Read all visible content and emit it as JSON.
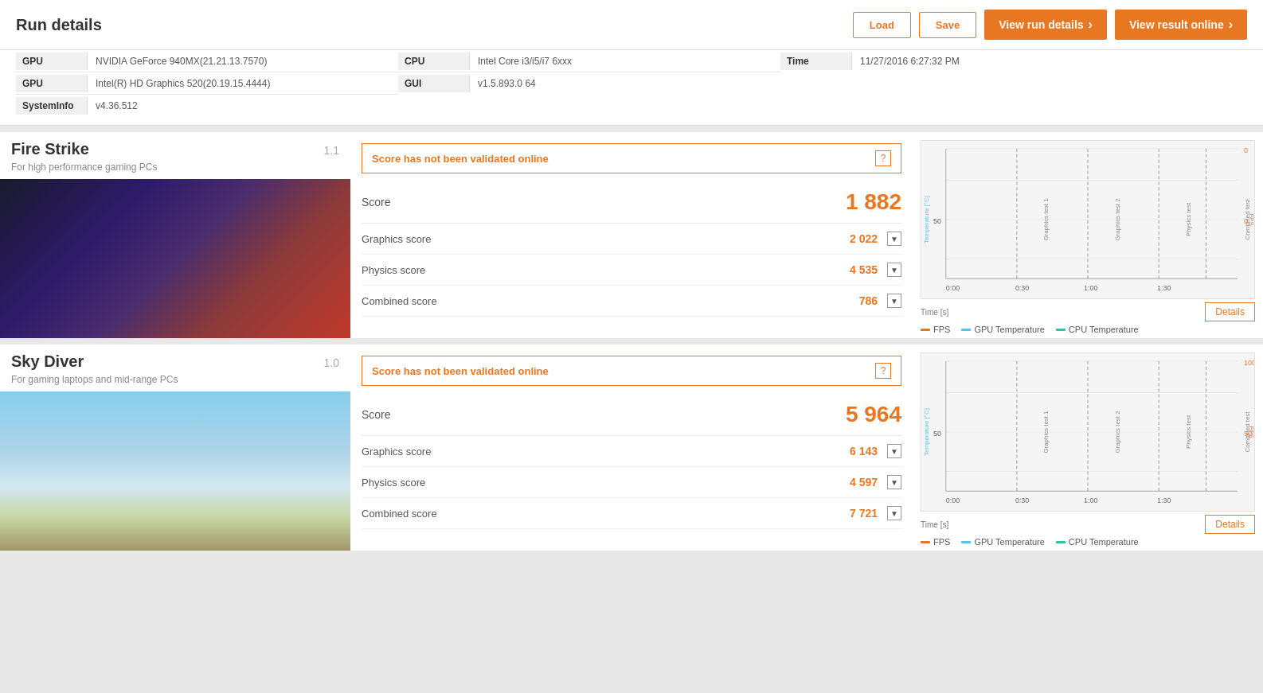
{
  "header": {
    "title": "Run details",
    "load_label": "Load",
    "save_label": "Save",
    "view_run_label": "View run details",
    "view_result_label": "View result online"
  },
  "sysinfo": {
    "rows_col1": [
      {
        "key": "GPU",
        "value": "NVIDIA GeForce 940MX(21.21.13.7570)"
      },
      {
        "key": "GPU",
        "value": "Intel(R) HD Graphics 520(20.19.15.4444)"
      },
      {
        "key": "SystemInfo",
        "value": "v4.36.512"
      }
    ],
    "rows_col2": [
      {
        "key": "CPU",
        "value": "Intel Core i3/i5/i7 6xxx"
      },
      {
        "key": "GUI",
        "value": "v1.5.893.0 64"
      }
    ],
    "rows_col3": [
      {
        "key": "Time",
        "value": "11/27/2016 6:27:32 PM"
      }
    ]
  },
  "benchmarks": [
    {
      "id": "firestrike",
      "title": "Fire Strike",
      "subtitle": "For high performance gaming PCs",
      "version": "1.1",
      "validation_text": "Score has not been validated online",
      "score_label": "Score",
      "score_value": "1 882",
      "rows": [
        {
          "label": "Graphics score",
          "value": "2 022"
        },
        {
          "label": "Physics score",
          "value": "4 535"
        },
        {
          "label": "Combined score",
          "value": "786"
        }
      ],
      "details_label": "Details",
      "chart": {
        "x_labels": [
          "0:00",
          "0:30",
          "1:00",
          "1:30"
        ],
        "y_left_label": "Temperature [°C]",
        "y_right_label": "FPS",
        "y_right_value": "0",
        "section_labels": [
          "Graphics test 1",
          "Graphics test 2",
          "Physics test",
          "Combined test"
        ],
        "fps_color": "#e87722",
        "gpu_temp_color": "#4fc3f7",
        "cpu_temp_color": "#26c6a0"
      },
      "legend": [
        {
          "label": "FPS",
          "color": "#e87722"
        },
        {
          "label": "GPU Temperature",
          "color": "#4fc3f7"
        },
        {
          "label": "CPU Temperature",
          "color": "#26c6a0"
        }
      ]
    },
    {
      "id": "skydiver",
      "title": "Sky Diver",
      "subtitle": "For gaming laptops and mid-range PCs",
      "version": "1.0",
      "validation_text": "Score has not been validated online",
      "score_label": "Score",
      "score_value": "5 964",
      "rows": [
        {
          "label": "Graphics score",
          "value": "6 143"
        },
        {
          "label": "Physics score",
          "value": "4 597"
        },
        {
          "label": "Combined score",
          "value": "7 721"
        }
      ],
      "details_label": "Details",
      "chart": {
        "x_labels": [
          "0:00",
          "0:30",
          "1:00",
          "1:30"
        ],
        "y_left_label": "Temperature [°C]",
        "y_right_label": "FPS",
        "y_right_value": "100",
        "section_labels": [
          "Graphics test 1",
          "Graphics test 2",
          "Physics test",
          "Combined test"
        ],
        "fps_color": "#e87722",
        "gpu_temp_color": "#4fc3f7",
        "cpu_temp_color": "#26c6a0"
      },
      "legend": [
        {
          "label": "FPS",
          "color": "#e87722"
        },
        {
          "label": "GPU Temperature",
          "color": "#4fc3f7"
        },
        {
          "label": "CPU Temperature",
          "color": "#26c6a0"
        }
      ]
    }
  ]
}
